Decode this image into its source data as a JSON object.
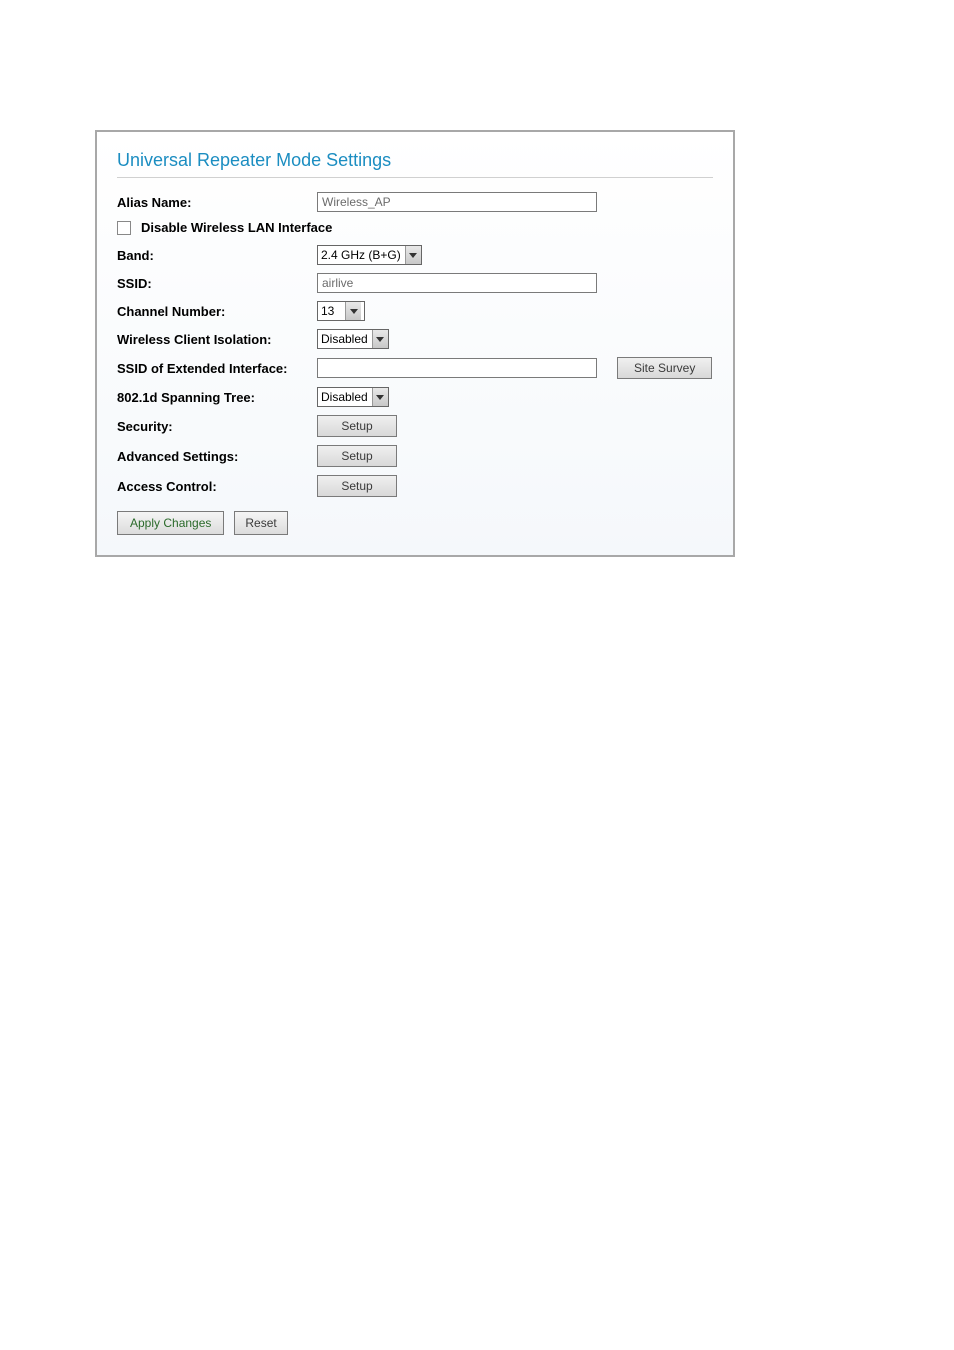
{
  "panel": {
    "title": "Universal Repeater Mode Settings"
  },
  "form": {
    "alias_name": {
      "label": "Alias Name:",
      "value": "Wireless_AP"
    },
    "disable_wlan": {
      "label": "Disable Wireless LAN Interface",
      "checked": false
    },
    "band": {
      "label": "Band:",
      "value": "2.4 GHz (B+G)"
    },
    "ssid": {
      "label": "SSID:",
      "value": "airlive"
    },
    "channel": {
      "label": "Channel Number:",
      "value": "13"
    },
    "isolation": {
      "label": "Wireless Client Isolation:",
      "value": "Disabled"
    },
    "ext_ssid": {
      "label": "SSID of Extended Interface:",
      "value": ""
    },
    "site_survey": {
      "label": "Site Survey"
    },
    "spanning_tree": {
      "label": "802.1d Spanning Tree:",
      "value": "Disabled"
    },
    "security": {
      "label": "Security:",
      "button": "Setup"
    },
    "advanced": {
      "label": "Advanced Settings:",
      "button": "Setup"
    },
    "access_control": {
      "label": "Access Control:",
      "button": "Setup"
    }
  },
  "footer": {
    "apply": "Apply Changes",
    "reset": "Reset"
  }
}
